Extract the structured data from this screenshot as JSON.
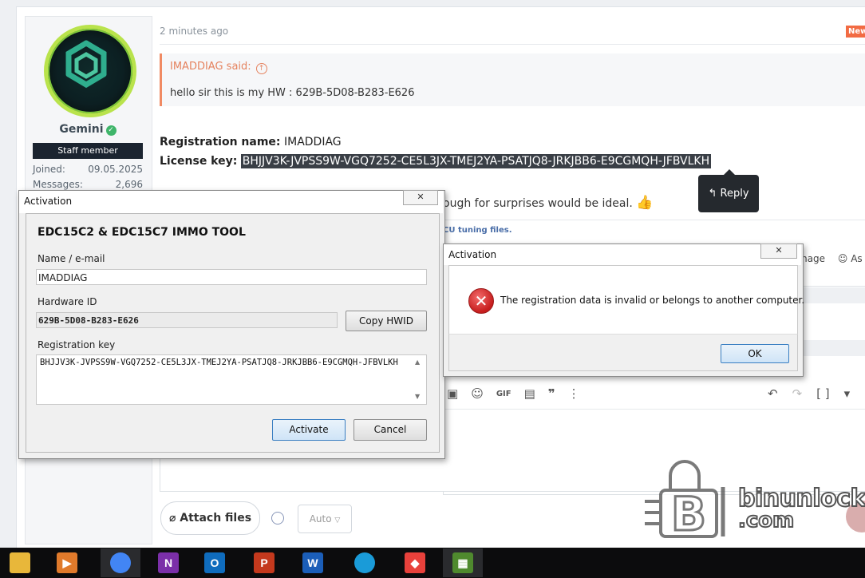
{
  "forum": {
    "user": {
      "name": "Gemini",
      "badge": "Staff member",
      "joined_label": "Joined:",
      "joined_value": "09.05.2025",
      "messages_label": "Messages:",
      "messages_value": "2,696"
    },
    "post_time": "2 minutes ago",
    "new_badge": "New",
    "quote": {
      "author": "IMADDIAG said:",
      "text": "hello sir this is my HW : 629B-5D08-B283-E626"
    },
    "registration_name_label": "Registration name:",
    "registration_name": "IMADDIAG",
    "license_key_label": "License key:",
    "license_key": "BHJJV3K-JVPSS9W-VGQ7252-CE5L3JX-TMEJ2YA-PSATJQ8-JRKJBB6-E9CGMQH-JFBVLKH",
    "reply_tooltip": "Reply",
    "partial_text": "ough for surprises would be ideal.",
    "thumb_emoji": "👍",
    "signature_partial": "CU tuning files.",
    "reaction_partial_1": "mage",
    "reaction_partial_2": "As",
    "attach_label": "Attach files",
    "auto_label": "Auto"
  },
  "watermark": {
    "line1": "binunlock",
    "line2": ".com"
  },
  "activation_dialog": {
    "title": "Activation",
    "close_glyph": "✕",
    "heading": "EDC15C2 & EDC15C7 IMMO TOOL",
    "name_label": "Name / e-mail",
    "name_value": "IMADDIAG",
    "hwid_label": "Hardware ID",
    "hwid_value": "629B-5D08-B283-E626",
    "copy_hwid_label": "Copy HWID",
    "regkey_label": "Registration key",
    "regkey_value": "BHJJV3K-JVPSS9W-VGQ7252-CE5L3JX-TMEJ2YA-PSATJQ8-JRKJBB6-E9CGMQH-JFBVLKH",
    "activate_label": "Activate",
    "cancel_label": "Cancel"
  },
  "error_dialog": {
    "title": "Activation",
    "close_glyph": "✕",
    "message": "The registration data is invalid or belongs to another computer.",
    "icon_glyph": "✕",
    "ok_label": "OK"
  },
  "taskbar": [
    {
      "name": "file-explorer",
      "glyph": "",
      "color": "#e8b73a"
    },
    {
      "name": "media-player",
      "glyph": "▶",
      "color": "#e07a2b"
    },
    {
      "name": "chrome",
      "glyph": "",
      "color": "#4285f4"
    },
    {
      "name": "onenote",
      "glyph": "N",
      "color": "#7b2fa8"
    },
    {
      "name": "outlook",
      "glyph": "O",
      "color": "#0f6cbd"
    },
    {
      "name": "powerpoint",
      "glyph": "P",
      "color": "#c4391d"
    },
    {
      "name": "word",
      "glyph": "W",
      "color": "#1b5eb8"
    },
    {
      "name": "edge",
      "glyph": "",
      "color": "#1a9bd8"
    },
    {
      "name": "anydesk",
      "glyph": "◆",
      "color": "#e8413b"
    },
    {
      "name": "chip-tool",
      "glyph": "▦",
      "color": "#4f8a2e"
    }
  ]
}
